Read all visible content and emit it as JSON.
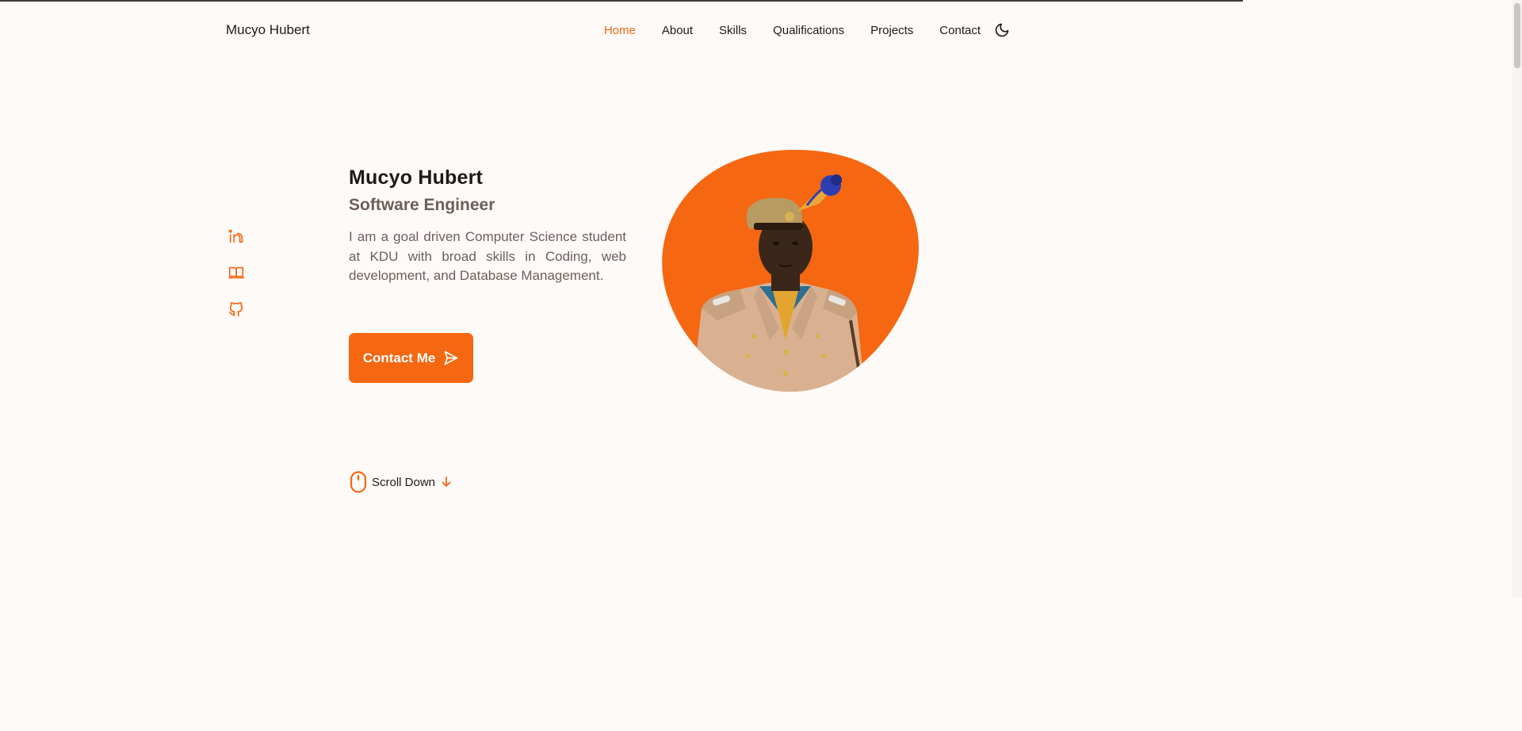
{
  "brand": {
    "name": "Mucyo Hubert"
  },
  "nav": {
    "items": [
      {
        "label": "Home",
        "active": true
      },
      {
        "label": "About",
        "active": false
      },
      {
        "label": "Skills",
        "active": false
      },
      {
        "label": "Qualifications",
        "active": false
      },
      {
        "label": "Projects",
        "active": false
      },
      {
        "label": "Contact",
        "active": false
      }
    ],
    "theme_toggle_icon": "moon-icon"
  },
  "social": [
    {
      "icon": "linkedin-icon"
    },
    {
      "icon": "book-icon"
    },
    {
      "icon": "github-icon"
    }
  ],
  "hero": {
    "title": "Mucyo Hubert",
    "subtitle": "Software Engineer",
    "description": "I am a goal driven Computer Science student at KDU with broad skills in Coding, web development, and Database Management.",
    "cta_label": "Contact Me",
    "cta_icon": "send-icon",
    "portrait": "person in beige ceremonial uniform with plumed beret on orange blob"
  },
  "scroll": {
    "label": "Scroll Down",
    "mouse_icon": "mouse-icon",
    "arrow_icon": "arrow-down-icon"
  },
  "colors": {
    "accent": "#f56711",
    "text": "#1f1a17",
    "muted": "#6c5f58",
    "background": "#fdfaf8"
  }
}
